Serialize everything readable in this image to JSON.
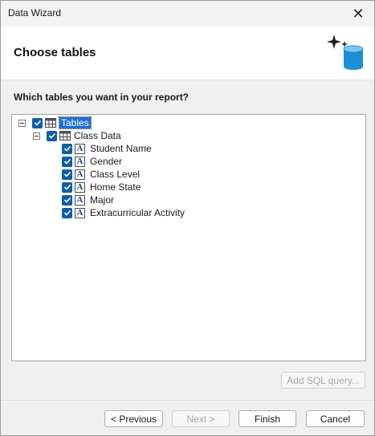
{
  "window": {
    "title": "Data Wizard",
    "close_glyph": "✕"
  },
  "header": {
    "title": "Choose tables",
    "icon": "database-sparkle-icon"
  },
  "prompt": "Which tables you want in your report?",
  "tree": {
    "root": {
      "label": "Tables",
      "checked": true,
      "expanded": true
    },
    "table": {
      "label": "Class Data",
      "checked": true,
      "expanded": true
    },
    "fields": [
      {
        "label": "Student Name",
        "checked": true
      },
      {
        "label": "Gender",
        "checked": true
      },
      {
        "label": "Class Level",
        "checked": true
      },
      {
        "label": "Home State",
        "checked": true
      },
      {
        "label": "Major",
        "checked": true
      },
      {
        "label": "Extracurricular Activity",
        "checked": true
      }
    ]
  },
  "buttons": {
    "add_sql": "Add SQL query...",
    "previous": "< Previous",
    "next": "Next >",
    "finish": "Finish",
    "cancel": "Cancel"
  },
  "colors": {
    "accent": "#0f5ea8",
    "selection": "#1e6fd9",
    "db_icon": "#1a8fd6"
  }
}
